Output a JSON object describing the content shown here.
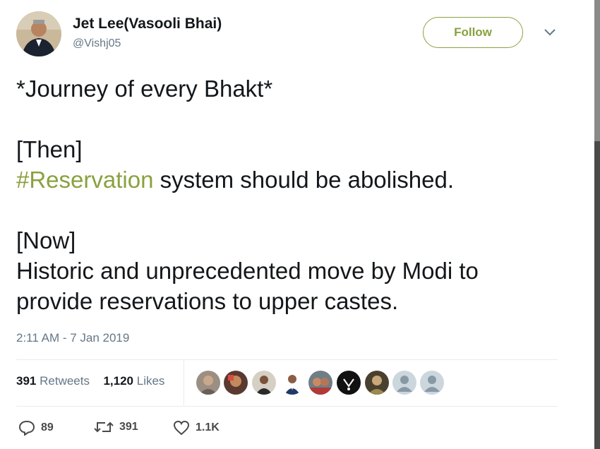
{
  "author": {
    "display_name": "Jet Lee(Vasooli Bhai)",
    "handle": "@Vishj05"
  },
  "follow_label": "Follow",
  "tweet": {
    "line1": "*Journey of every Bhakt*",
    "line2": "[Then]",
    "hashtag": "#Reservation",
    "line3_rest": " system should be abolished.",
    "line4": "[Now]",
    "line5": "Historic and unprecedented move by Modi to",
    "line6": "provide reservations to upper castes."
  },
  "timestamp": "2:11 AM - 7 Jan 2019",
  "stats": {
    "retweets_count": "391",
    "retweets_label": "Retweets",
    "likes_count": "1,120",
    "likes_label": "Likes"
  },
  "actions": {
    "replies": "89",
    "retweets": "391",
    "likes": "1.1K"
  },
  "colors": {
    "accent": "#8aa13f",
    "secondary_text": "#657786",
    "primary_text": "#14171a"
  }
}
